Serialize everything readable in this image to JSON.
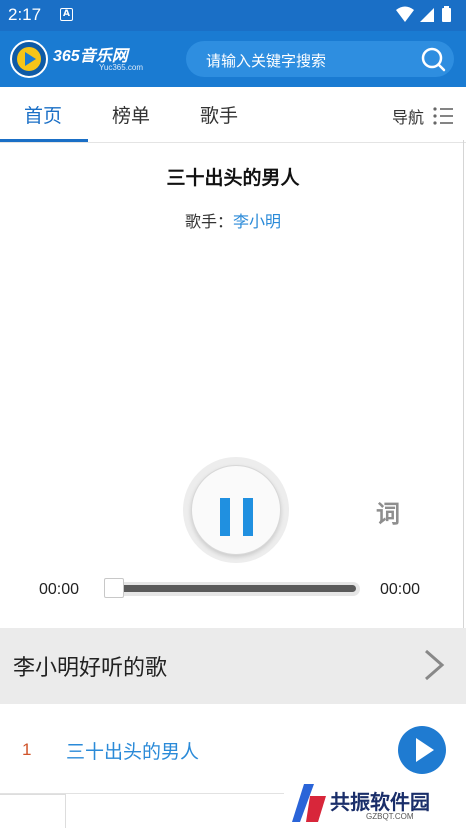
{
  "status_bar": {
    "time": "2:17",
    "notification_glyph": "A"
  },
  "app_header": {
    "logo_text": "365音乐网",
    "logo_subtext": "Yuc365.com",
    "search_placeholder": "请输入关键字搜索"
  },
  "tabs": [
    {
      "label": "首页",
      "active": true
    },
    {
      "label": "榜单",
      "active": false
    },
    {
      "label": "歌手",
      "active": false
    }
  ],
  "nav": {
    "label": "导航"
  },
  "song": {
    "title": "三十出头的男人",
    "singer_label": "歌手：",
    "singer_name": "李小明"
  },
  "player": {
    "lyric_button": "词",
    "time_current": "00:00",
    "time_total": "00:00",
    "progress": 0
  },
  "section": {
    "title": "李小明好听的歌",
    "songs": [
      {
        "index": "1",
        "name": "三十出头的男人"
      }
    ]
  },
  "watermark": {
    "text": "共振软件园",
    "subtext": "GZBQT.COM"
  },
  "colors": {
    "brand_blue": "#1a7bd2",
    "status_bar": "#1a6fc6",
    "accent_link": "#2a8ad8",
    "index_orange": "#d0542a"
  },
  "icons": [
    "wifi-icon",
    "signal-icon",
    "battery-icon",
    "search-icon",
    "menu-list-icon",
    "pause-icon",
    "chevron-right-icon",
    "play-icon"
  ]
}
